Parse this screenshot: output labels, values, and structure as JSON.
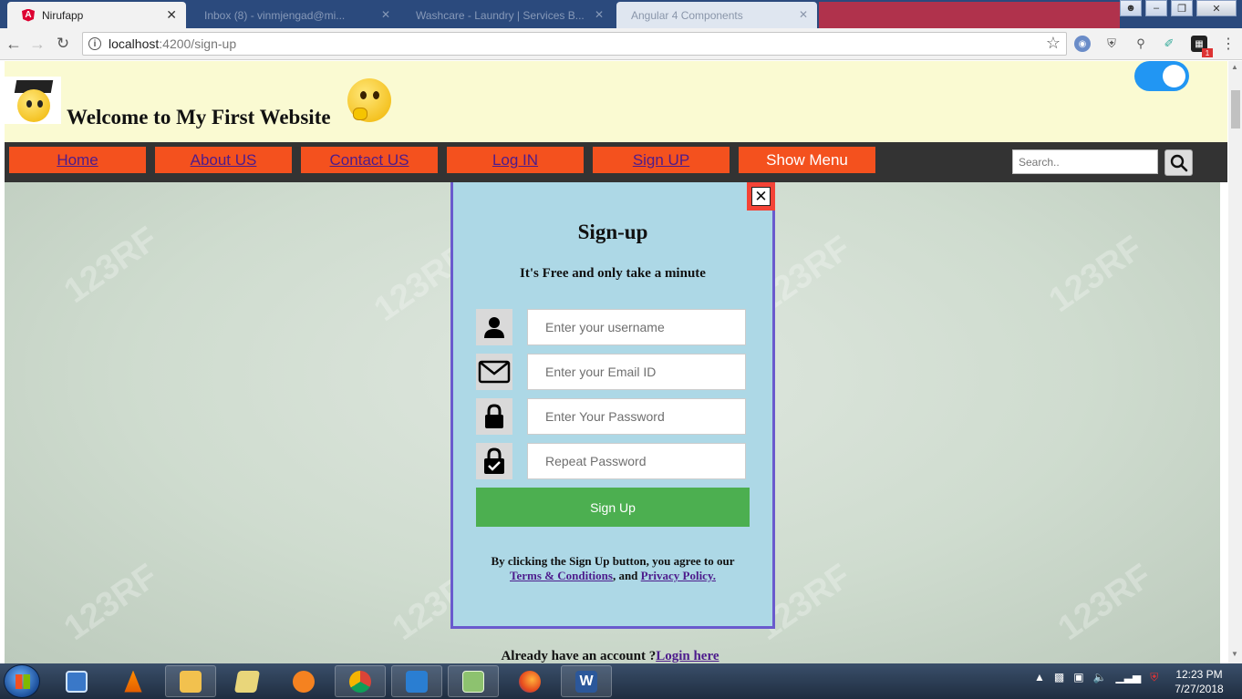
{
  "browser": {
    "active_tab": {
      "title": "Nirufapp",
      "favicon": "A"
    },
    "background_tabs": [
      "Inbox (8) - vinmjengad@mi...",
      "Washcare - Laundry | Services B...",
      "Angular 4 Components"
    ],
    "url_host": "localhost",
    "url_path": ":4200/sign-up",
    "extension_badge": "1"
  },
  "site": {
    "title": "Welcome to My First Website",
    "nav": {
      "home": "Home",
      "about": "About US",
      "contact": "Contact US",
      "login": "Log IN",
      "signup": "Sign UP",
      "show_menu": "Show Menu"
    },
    "search": {
      "placeholder": "Search.."
    },
    "toggle_on": true,
    "watermark_text": "123RF"
  },
  "signup_modal": {
    "title": "Sign-up",
    "subtitle": "It's Free and only take a minute",
    "fields": {
      "username": {
        "placeholder": "Enter your username",
        "icon": "user-icon"
      },
      "email": {
        "placeholder": "Enter your Email ID",
        "icon": "envelope-icon"
      },
      "password": {
        "placeholder": "Enter Your Password",
        "icon": "lock-icon"
      },
      "repeat": {
        "placeholder": "Repeat Password",
        "icon": "lock-check-icon"
      }
    },
    "submit_label": "Sign Up",
    "terms_prefix": "By clicking the Sign Up button, you agree to our",
    "terms_link": "Terms & Conditions",
    "terms_and": ", and",
    "privacy_link": "Privacy Policy.",
    "close_label": "✕"
  },
  "already_account": {
    "text": "Already have an account ?",
    "link": "Login here"
  },
  "taskbar": {
    "time": "12:23 PM",
    "date": "7/27/2018",
    "word_letter": "W"
  },
  "colors": {
    "nav_button": "#f4511e",
    "header_bg": "#fafad2",
    "modal_bg": "#add8e6",
    "modal_border": "#6a5acd",
    "submit_bg": "#4caf50",
    "toggle": "#2196f3"
  }
}
